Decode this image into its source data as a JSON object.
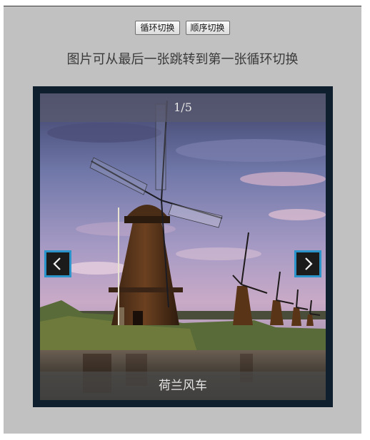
{
  "controls": {
    "loop_label": "循环切换",
    "sequence_label": "顺序切换"
  },
  "description": "图片可从最后一张跳转到第一张循环切换",
  "slider": {
    "counter": "1/5",
    "caption": "荷兰风车",
    "prev_icon": "chevron-left-icon",
    "next_icon": "chevron-right-icon",
    "accent_color": "#2a93c9",
    "frame_color": "#0f1f2e"
  }
}
